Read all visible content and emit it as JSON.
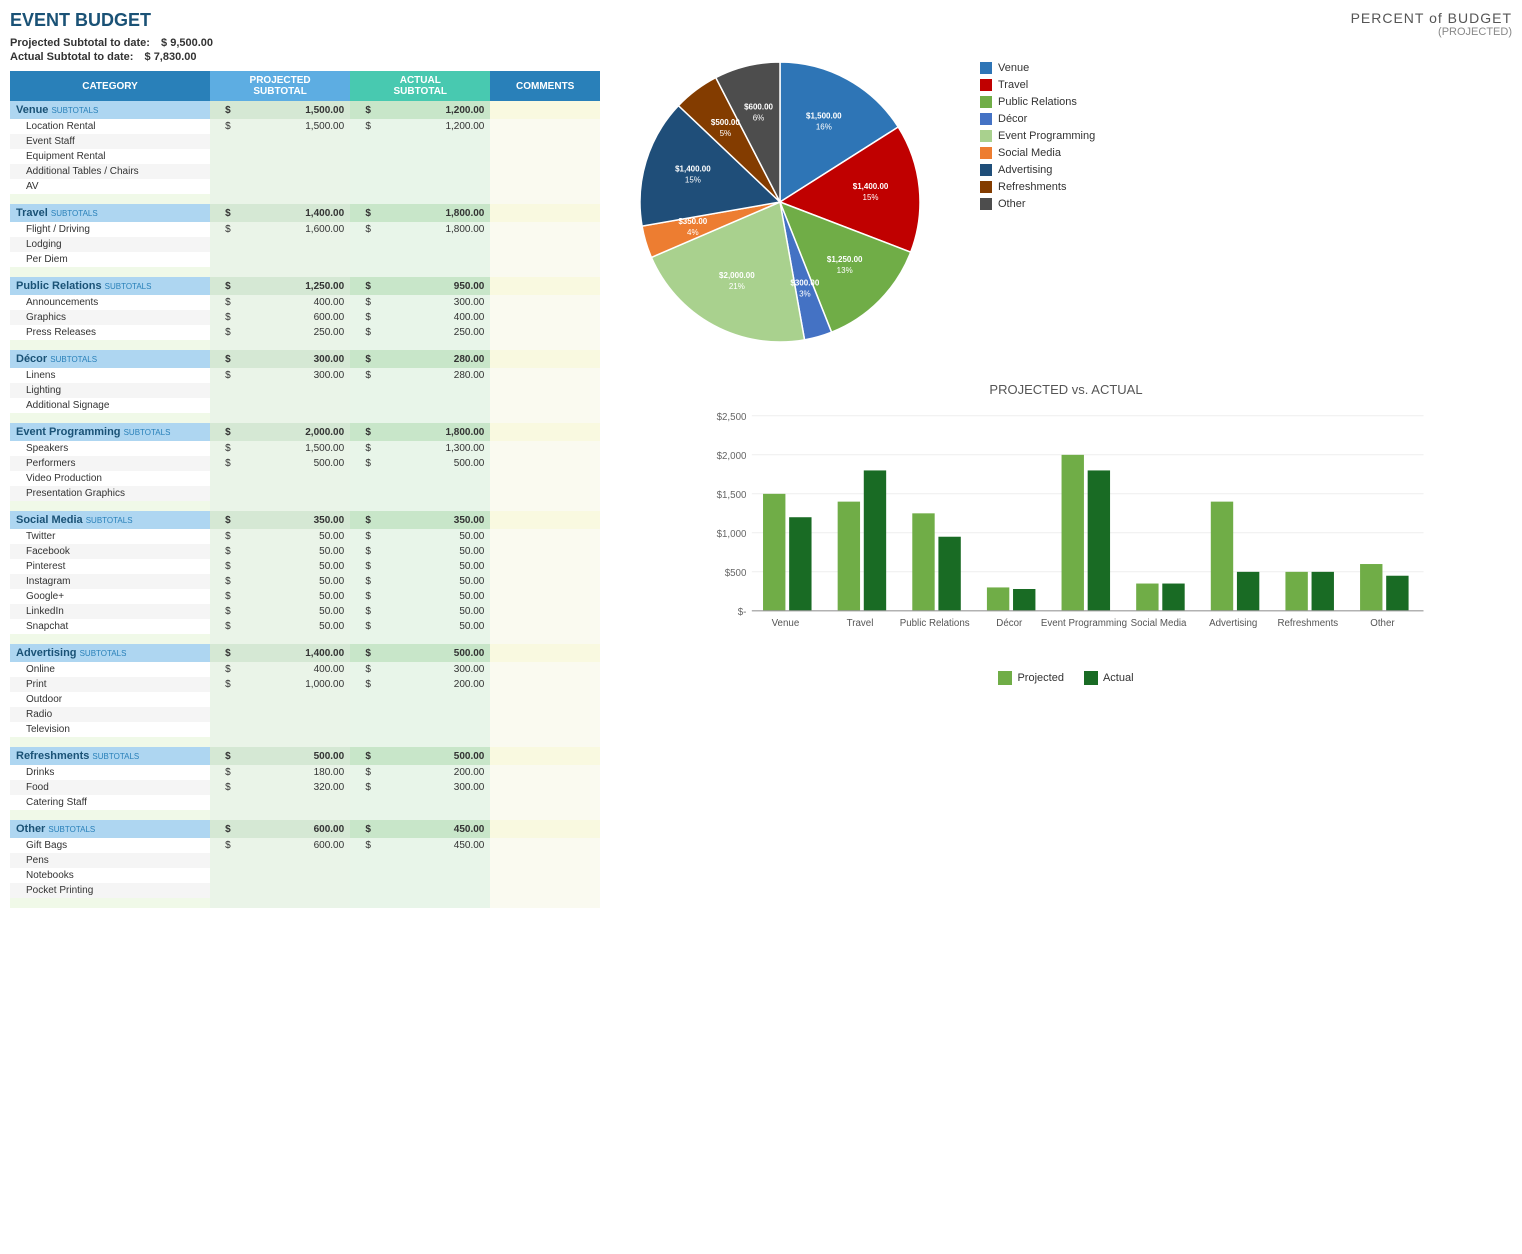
{
  "title": "EVENT BUDGET",
  "projected_subtotal_label": "Projected Subtotal to date:",
  "actual_subtotal_label": "Actual Subtotal to date:",
  "projected_subtotal_value": "$ 9,500.00",
  "actual_subtotal_value": "$ 7,830.00",
  "table": {
    "headers": [
      "CATEGORY",
      "PROJECTED SUBTOTAL",
      "ACTUAL SUBTOTAL",
      "COMMENTS"
    ],
    "sections": [
      {
        "name": "Venue",
        "projected": "1,500.00",
        "actual": "1,200.00",
        "items": [
          {
            "name": "Location Rental",
            "proj": "1,500.00",
            "actual": "1,200.00"
          },
          {
            "name": "Event Staff",
            "proj": "",
            "actual": ""
          },
          {
            "name": "Equipment Rental",
            "proj": "",
            "actual": ""
          },
          {
            "name": "Additional Tables / Chairs",
            "proj": "",
            "actual": ""
          },
          {
            "name": "AV",
            "proj": "",
            "actual": ""
          }
        ]
      },
      {
        "name": "Travel",
        "projected": "1,400.00",
        "actual": "1,800.00",
        "items": [
          {
            "name": "Flight / Driving",
            "proj": "1,600.00",
            "actual": "1,800.00"
          },
          {
            "name": "Lodging",
            "proj": "",
            "actual": ""
          },
          {
            "name": "Per Diem",
            "proj": "",
            "actual": ""
          }
        ]
      },
      {
        "name": "Public Relations",
        "projected": "1,250.00",
        "actual": "950.00",
        "items": [
          {
            "name": "Announcements",
            "proj": "400.00",
            "actual": "300.00"
          },
          {
            "name": "Graphics",
            "proj": "600.00",
            "actual": "400.00"
          },
          {
            "name": "Press Releases",
            "proj": "250.00",
            "actual": "250.00"
          }
        ]
      },
      {
        "name": "Décor",
        "projected": "300.00",
        "actual": "280.00",
        "items": [
          {
            "name": "Linens",
            "proj": "300.00",
            "actual": "280.00"
          },
          {
            "name": "Lighting",
            "proj": "",
            "actual": ""
          },
          {
            "name": "Additional Signage",
            "proj": "",
            "actual": ""
          }
        ]
      },
      {
        "name": "Event Programming",
        "projected": "2,000.00",
        "actual": "1,800.00",
        "items": [
          {
            "name": "Speakers",
            "proj": "1,500.00",
            "actual": "1,300.00"
          },
          {
            "name": "Performers",
            "proj": "500.00",
            "actual": "500.00"
          },
          {
            "name": "Video Production",
            "proj": "",
            "actual": ""
          },
          {
            "name": "Presentation Graphics",
            "proj": "",
            "actual": ""
          }
        ]
      },
      {
        "name": "Social Media",
        "projected": "350.00",
        "actual": "350.00",
        "items": [
          {
            "name": "Twitter",
            "proj": "50.00",
            "actual": "50.00"
          },
          {
            "name": "Facebook",
            "proj": "50.00",
            "actual": "50.00"
          },
          {
            "name": "Pinterest",
            "proj": "50.00",
            "actual": "50.00"
          },
          {
            "name": "Instagram",
            "proj": "50.00",
            "actual": "50.00"
          },
          {
            "name": "Google+",
            "proj": "50.00",
            "actual": "50.00"
          },
          {
            "name": "LinkedIn",
            "proj": "50.00",
            "actual": "50.00"
          },
          {
            "name": "Snapchat",
            "proj": "50.00",
            "actual": "50.00"
          }
        ]
      },
      {
        "name": "Advertising",
        "projected": "1,400.00",
        "actual": "500.00",
        "items": [
          {
            "name": "Online",
            "proj": "400.00",
            "actual": "300.00"
          },
          {
            "name": "Print",
            "proj": "1,000.00",
            "actual": "200.00"
          },
          {
            "name": "Outdoor",
            "proj": "",
            "actual": ""
          },
          {
            "name": "Radio",
            "proj": "",
            "actual": ""
          },
          {
            "name": "Television",
            "proj": "",
            "actual": ""
          }
        ]
      },
      {
        "name": "Refreshments",
        "projected": "500.00",
        "actual": "500.00",
        "items": [
          {
            "name": "Drinks",
            "proj": "180.00",
            "actual": "200.00"
          },
          {
            "name": "Food",
            "proj": "320.00",
            "actual": "300.00"
          },
          {
            "name": "Catering Staff",
            "proj": "",
            "actual": ""
          }
        ]
      },
      {
        "name": "Other",
        "projected": "600.00",
        "actual": "450.00",
        "items": [
          {
            "name": "Gift Bags",
            "proj": "600.00",
            "actual": "450.00"
          },
          {
            "name": "Pens",
            "proj": "",
            "actual": ""
          },
          {
            "name": "Notebooks",
            "proj": "",
            "actual": ""
          },
          {
            "name": "Pocket Printing",
            "proj": "",
            "actual": ""
          }
        ]
      }
    ]
  },
  "pie_chart": {
    "title": "PERCENT of BUDGET",
    "subtitle": "(PROJECTED)",
    "segments": [
      {
        "label": "Venue",
        "value": 1500,
        "percent": "16%",
        "color": "#2e75b6",
        "angle_start": 0,
        "angle_end": 57.6
      },
      {
        "label": "Travel",
        "value": 1400,
        "percent": "15%",
        "color": "#c00000",
        "angle_start": 57.6,
        "angle_end": 111
      },
      {
        "label": "Public Relations",
        "value": 1250,
        "percent": "13%",
        "color": "#70ad47",
        "angle_start": 111,
        "angle_end": 158.4
      },
      {
        "label": "Décor",
        "value": 300,
        "percent": "3%",
        "color": "#4472c4",
        "angle_start": 158.4,
        "angle_end": 169.9
      },
      {
        "label": "Event Programming",
        "value": 2000,
        "percent": "21%",
        "color": "#a9d18e",
        "angle_start": 169.9,
        "angle_end": 246.7
      },
      {
        "label": "Social Media",
        "value": 350,
        "percent": "4%",
        "color": "#ed7d31",
        "angle_start": 246.7,
        "angle_end": 260.1
      },
      {
        "label": "Advertising",
        "value": 1400,
        "percent": "15%",
        "color": "#1f4e79",
        "angle_start": 260.1,
        "angle_end": 313.5
      },
      {
        "label": "Refreshments",
        "value": 500,
        "percent": "5%",
        "color": "#833c00",
        "angle_start": 313.5,
        "angle_end": 332.7
      },
      {
        "label": "Other",
        "value": 600,
        "percent": "6%",
        "color": "#4d4d4d",
        "angle_start": 332.7,
        "angle_end": 360
      }
    ]
  },
  "bar_chart": {
    "title": "PROJECTED vs. ACTUAL",
    "categories": [
      "Venue",
      "Travel",
      "Public Relations",
      "Décor",
      "Event Programming",
      "Social Media",
      "Advertising",
      "Refreshments",
      "Other"
    ],
    "projected": [
      1500,
      1400,
      1250,
      300,
      2000,
      350,
      1400,
      500,
      600
    ],
    "actual": [
      1200,
      1800,
      950,
      280,
      1800,
      350,
      500,
      500,
      450
    ],
    "max_value": 2500,
    "y_labels": [
      "$2,500",
      "$2,000",
      "$1,500",
      "$1,000",
      "$500",
      "$-"
    ],
    "projected_color": "#70ad47",
    "actual_color": "#196b24",
    "legend": {
      "projected": "Projected",
      "actual": "Actual"
    }
  }
}
